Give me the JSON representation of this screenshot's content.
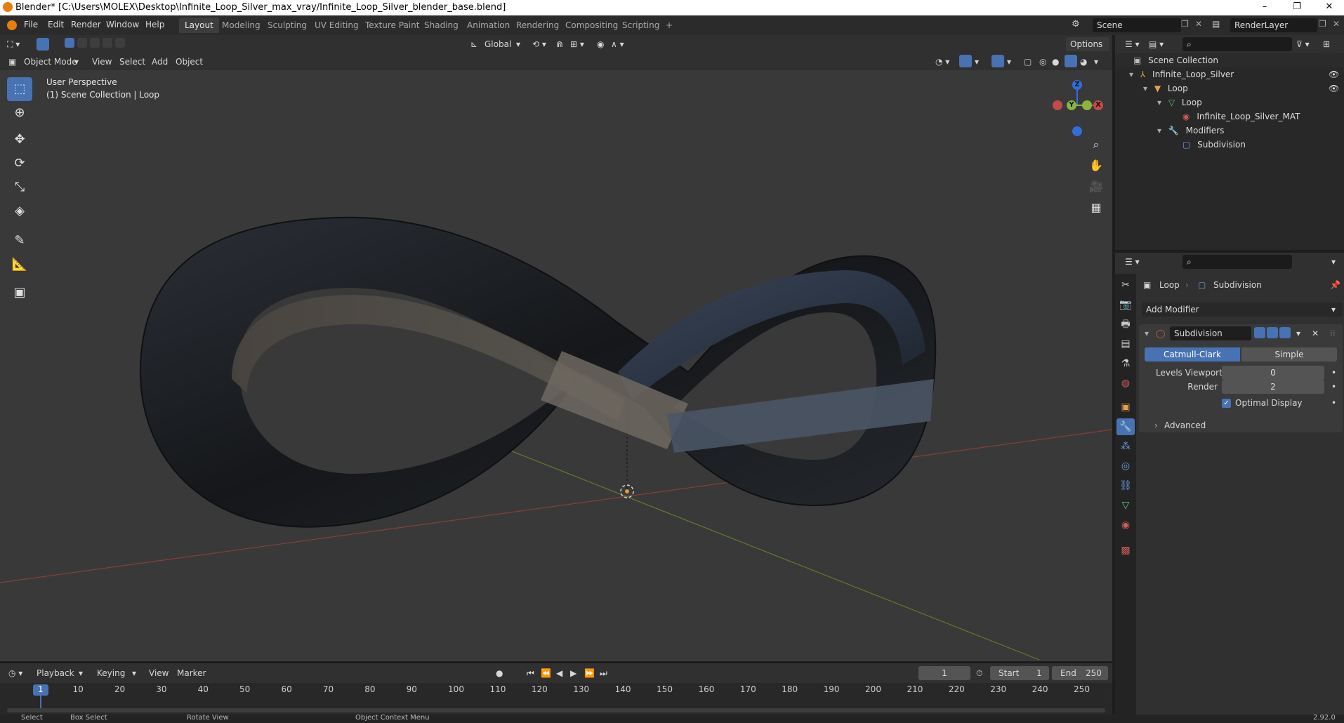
{
  "window": {
    "title": "Blender* [C:\\Users\\MOLEX\\Desktop\\Infinite_Loop_Silver_max_vray/Infinite_Loop_Silver_blender_base.blend]",
    "controls": [
      "–",
      "❐",
      "✕"
    ]
  },
  "menu": [
    "File",
    "Edit",
    "Render",
    "Window",
    "Help"
  ],
  "workspaces": [
    "Layout",
    "Modeling",
    "Sculpting",
    "UV Editing",
    "Texture Paint",
    "Shading",
    "Animation",
    "Rendering",
    "Compositing",
    "Scripting",
    "+"
  ],
  "active_workspace": "Layout",
  "scene": {
    "name": "Scene",
    "view_layer": "RenderLayer"
  },
  "viewport_header": {
    "transform_orientation": "Global",
    "options_label": "Options",
    "mode": "Object Mode",
    "menus": [
      "View",
      "Select",
      "Add",
      "Object"
    ]
  },
  "viewport": {
    "overlay_line1": "User Perspective",
    "overlay_line2": "(1) Scene Collection | Loop",
    "gizmo_axes": {
      "z": "Z",
      "y": "Y",
      "x": "X"
    }
  },
  "outliner": {
    "rows": [
      {
        "label": "Scene Collection"
      },
      {
        "label": "Infinite_Loop_Silver"
      },
      {
        "label": "Loop"
      },
      {
        "label": "Loop"
      },
      {
        "label": "Infinite_Loop_Silver_MAT"
      },
      {
        "label": "Modifiers"
      },
      {
        "label": "Subdivision"
      }
    ]
  },
  "properties": {
    "breadcrumb_object": "Loop",
    "breadcrumb_modifier": "Subdivision",
    "add_modifier_label": "Add Modifier",
    "modifier_name": "Subdivision",
    "algorithm_options": [
      "Catmull-Clark",
      "Simple"
    ],
    "active_algorithm": "Catmull-Clark",
    "levels_viewport_label": "Levels Viewport",
    "levels_viewport_value": "0",
    "render_label": "Render",
    "render_value": "2",
    "optimal_display_label": "Optimal Display",
    "optimal_display_checked": true,
    "advanced_label": "Advanced"
  },
  "timeline": {
    "menus": [
      "Playback",
      "Keying",
      "View",
      "Marker"
    ],
    "current_frame": "1",
    "start_label": "Start",
    "start_value": "1",
    "end_label": "End",
    "end_value": "250",
    "ticks": [
      "1",
      "10",
      "20",
      "30",
      "40",
      "50",
      "60",
      "70",
      "80",
      "90",
      "100",
      "110",
      "120",
      "130",
      "140",
      "150",
      "160",
      "170",
      "180",
      "190",
      "200",
      "210",
      "220",
      "230",
      "240",
      "250"
    ]
  },
  "status_bar": [
    "Select",
    "Box Select",
    "Rotate View",
    "Object Context Menu",
    "2.92.0"
  ],
  "colors": {
    "accent": "#4772b3",
    "viewport_bg": "#393939",
    "panel_bg": "#303030",
    "x_axis": "#c44a4a",
    "y_axis": "#8ab43c",
    "z_axis": "#2f6fdb"
  }
}
